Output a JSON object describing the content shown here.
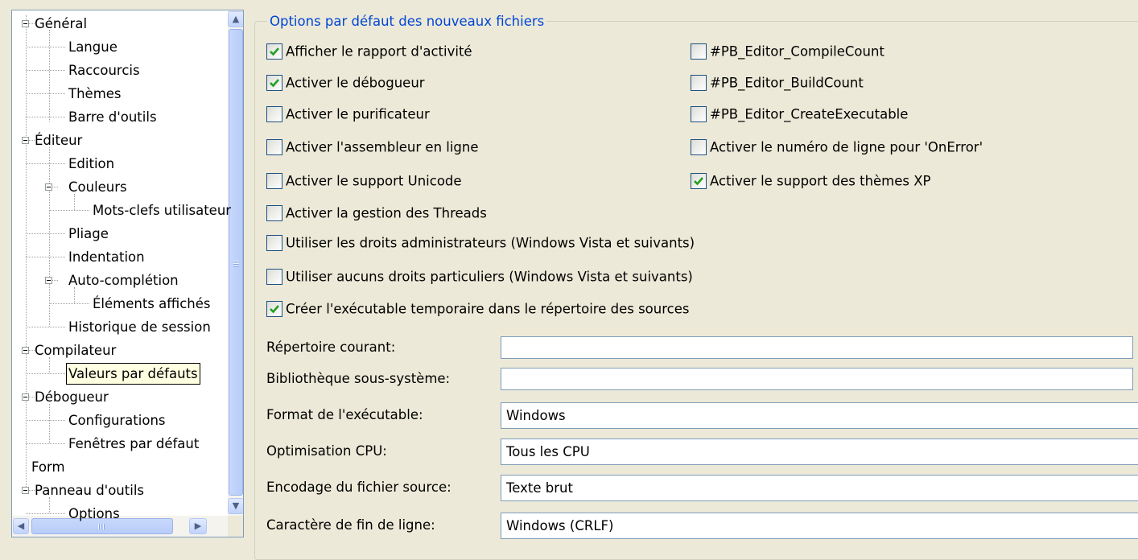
{
  "tree": {
    "items": [
      {
        "label": "Général"
      },
      {
        "label": "Langue"
      },
      {
        "label": "Raccourcis"
      },
      {
        "label": "Thèmes"
      },
      {
        "label": "Barre d'outils"
      },
      {
        "label": "Éditeur"
      },
      {
        "label": "Edition"
      },
      {
        "label": "Couleurs"
      },
      {
        "label": "Mots-clefs utilisateur"
      },
      {
        "label": "Pliage"
      },
      {
        "label": "Indentation"
      },
      {
        "label": "Auto-complétion"
      },
      {
        "label": "Éléments affichés"
      },
      {
        "label": "Historique de session"
      },
      {
        "label": "Compilateur"
      },
      {
        "label": "Valeurs par défauts"
      },
      {
        "label": "Débogueur"
      },
      {
        "label": "Configurations"
      },
      {
        "label": "Fenêtres par défaut"
      },
      {
        "label": "Form"
      },
      {
        "label": "Panneau d'outils"
      },
      {
        "label": "Options"
      }
    ],
    "selected": "Valeurs par défauts"
  },
  "group": {
    "title": "Options par défaut des nouveaux fichiers"
  },
  "checkboxes": {
    "left": [
      {
        "label": "Afficher le rapport d'activité",
        "checked": true
      },
      {
        "label": "Activer le débogueur",
        "checked": true
      },
      {
        "label": "Activer le purificateur",
        "checked": false
      },
      {
        "label": "Activer l'assembleur en ligne",
        "checked": false
      },
      {
        "label": "Activer le support Unicode",
        "checked": false
      },
      {
        "label": "Activer la gestion des Threads",
        "checked": false
      },
      {
        "label": "Utiliser les droits administrateurs (Windows Vista et suivants)",
        "checked": false
      },
      {
        "label": "Utiliser aucuns droits particuliers (Windows Vista et suivants)",
        "checked": false
      },
      {
        "label": "Créer l'exécutable temporaire dans le répertoire des sources",
        "checked": true
      }
    ],
    "right": [
      {
        "label": "#PB_Editor_CompileCount",
        "checked": false
      },
      {
        "label": "#PB_Editor_BuildCount",
        "checked": false
      },
      {
        "label": "#PB_Editor_CreateExecutable",
        "checked": false
      },
      {
        "label": "Activer le numéro de ligne pour 'OnError'",
        "checked": false
      },
      {
        "label": "Activer le support des thèmes XP",
        "checked": true
      }
    ]
  },
  "fields": [
    {
      "label": "Répertoire courant:",
      "value": ""
    },
    {
      "label": "Bibliothèque sous-système:",
      "value": ""
    },
    {
      "label": "Format de l'exécutable:",
      "value": "Windows"
    },
    {
      "label": "Optimisation CPU:",
      "value": "Tous les CPU"
    },
    {
      "label": "Encodage du fichier source:",
      "value": "Texte brut"
    },
    {
      "label": "Caractère de fin de ligne:",
      "value": "Windows (CRLF)"
    }
  ],
  "icons": {
    "scroll_up": "chevron-up-icon",
    "scroll_down": "chevron-down-icon",
    "scroll_left": "chevron-left-icon",
    "scroll_right": "chevron-right-icon",
    "check": "checkmark-icon",
    "collapse": "minus-icon"
  },
  "colors": {
    "legend": "#0046D5",
    "check": "#21A121",
    "window": "#ECE9D8"
  }
}
